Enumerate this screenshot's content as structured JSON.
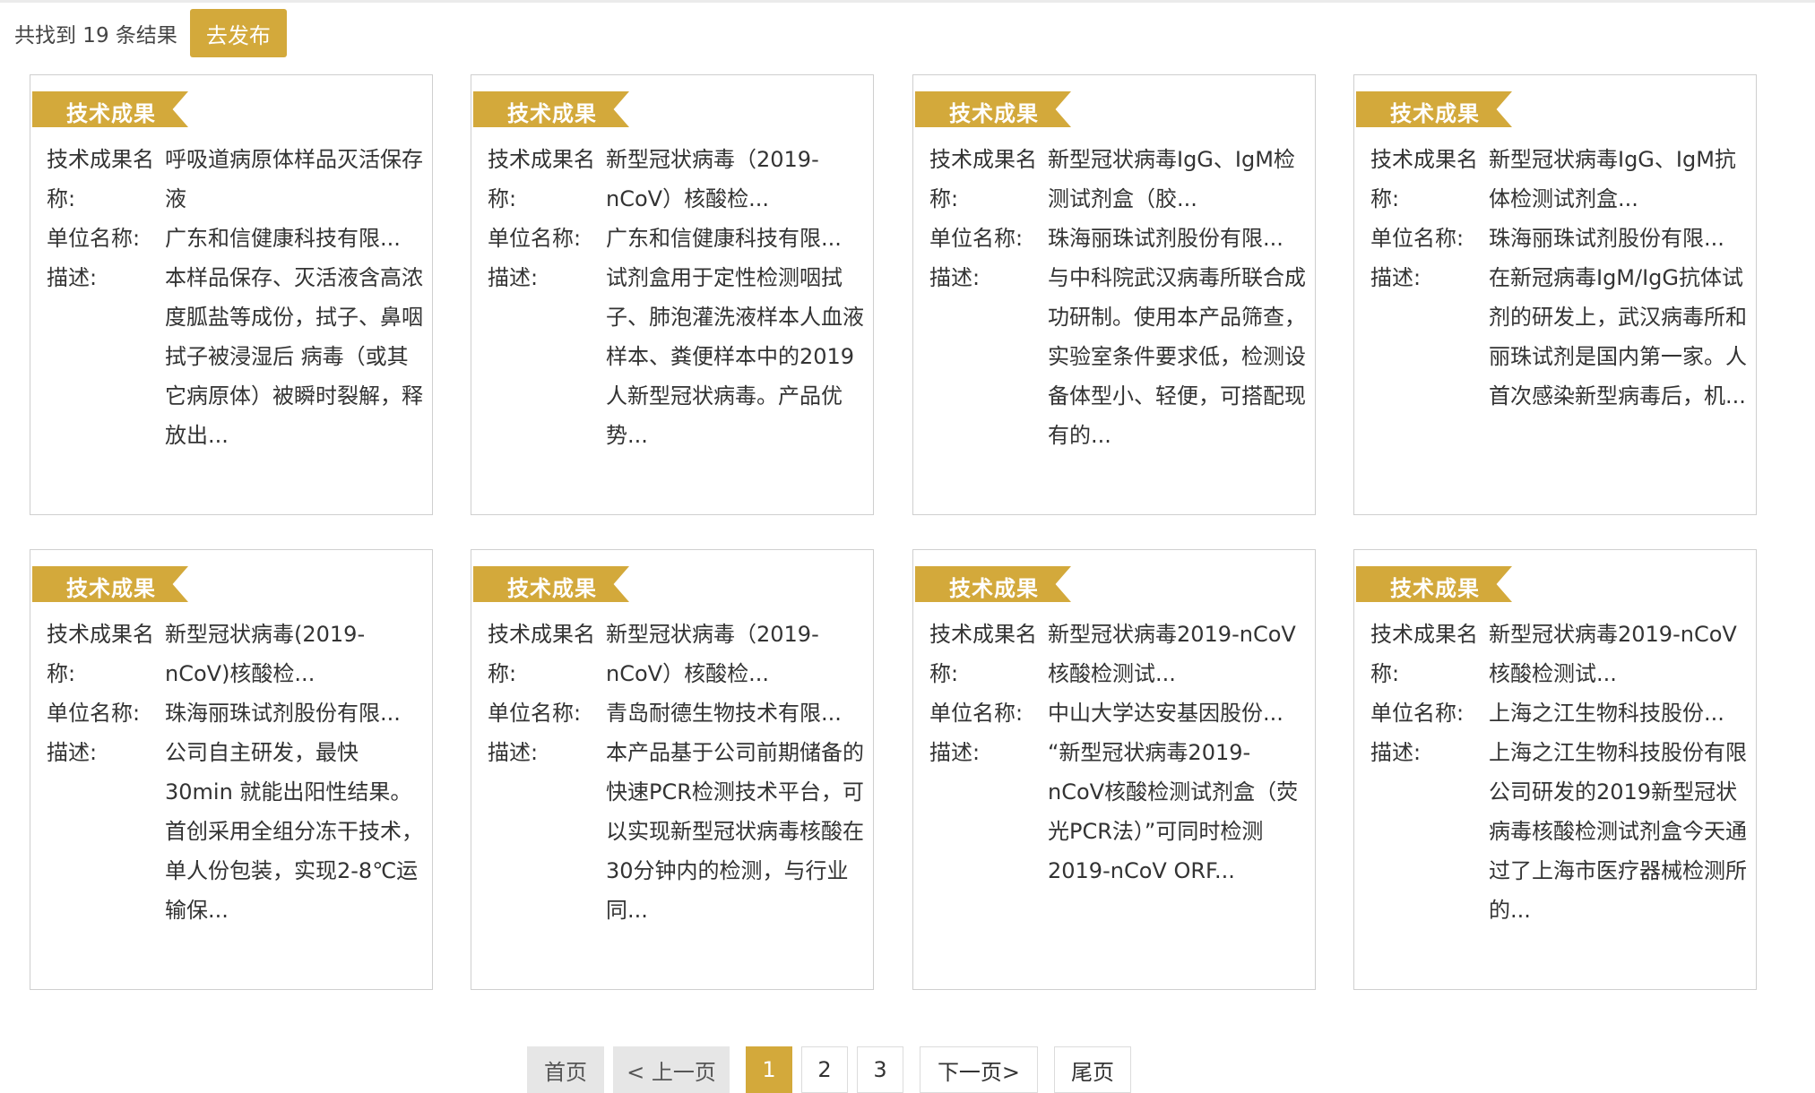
{
  "header": {
    "result_count": "共找到 19 条结果",
    "publish_label": "去发布"
  },
  "labels": {
    "badge": "技术成果",
    "name_label": "技术成果名称:",
    "org_label": "单位名称:",
    "desc_label": "描述:"
  },
  "cards": [
    {
      "name": "呼吸道病原体样品灭活保存液",
      "org": "广东和信健康科技有限...",
      "desc": "本样品保存、灭活液含高浓度胍盐等成份，拭子、鼻咽拭子被浸湿后 病毒（或其它病原体）被瞬时裂解，释放出..."
    },
    {
      "name": "新型冠状病毒（2019-nCoV）核酸检...",
      "org": "广东和信健康科技有限...",
      "desc": "试剂盒用于定性检测咽拭子、肺泡灌洗液样本人血液样本、粪便样本中的2019人新型冠状病毒。产品优势..."
    },
    {
      "name": "新型冠状病毒IgG、IgM检测试剂盒（胶...",
      "org": "珠海丽珠试剂股份有限...",
      "desc": "与中科院武汉病毒所联合成功研制。使用本产品筛查，实验室条件要求低，检测设备体型小、轻便，可搭配现有的..."
    },
    {
      "name": "新型冠状病毒IgG、IgM抗体检测试剂盒...",
      "org": "珠海丽珠试剂股份有限...",
      "desc": "在新冠病毒IgM/IgG抗体试剂的研发上，武汉病毒所和丽珠试剂是国内第一家。人首次感染新型病毒后，机..."
    },
    {
      "name": "新型冠状病毒(2019-nCoV)核酸检...",
      "org": "珠海丽珠试剂股份有限...",
      "desc": "公司自主研发，最快30min 就能出阳性结果。首创采用全组分冻干技术，单人份包装，实现2-8℃运输保..."
    },
    {
      "name": "新型冠状病毒（2019-nCoV）核酸检...",
      "org": "青岛耐德生物技术有限...",
      "desc": "本产品基于公司前期储备的快速PCR检测技术平台，可以实现新型冠状病毒核酸在30分钟内的检测，与行业同..."
    },
    {
      "name": "新型冠状病毒2019-nCoV核酸检测试...",
      "org": "中山大学达安基因股份...",
      "desc": "“新型冠状病毒2019-nCoV核酸检测试剂盒（荧光PCR法）”可同时检测2019-nCoV ORF..."
    },
    {
      "name": "新型冠状病毒2019-nCoV核酸检测试...",
      "org": "上海之江生物科技股份...",
      "desc": "上海之江生物科技股份有限公司研发的2019新型冠状病毒核酸检测试剂盒今天通过了上海市医疗器械检测所的..."
    }
  ],
  "pagination": {
    "first": "首页",
    "prev": "< 上一页",
    "pages": [
      "1",
      "2",
      "3"
    ],
    "current": "1",
    "next": "下一页>",
    "last": "尾页"
  },
  "colors": {
    "accent": "#d3a93b"
  }
}
